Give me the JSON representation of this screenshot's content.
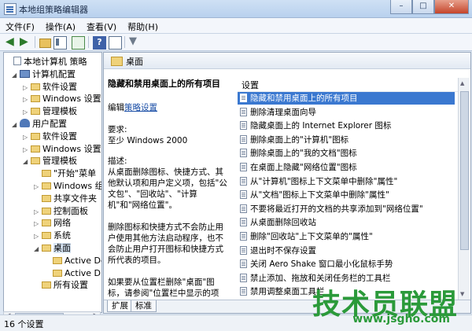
{
  "window": {
    "title": "本地组策略编辑器",
    "buttons": [
      "–",
      "□",
      "✕"
    ]
  },
  "menu": [
    "文件(F)",
    "操作(A)",
    "查看(V)",
    "帮助(H)"
  ],
  "toolbar": {
    "icons": [
      "back-icon",
      "forward-icon",
      "up-folder-icon",
      "show-hide-tree-icon",
      "export-list-icon",
      "help-icon",
      "properties-icon",
      "filter-icon"
    ]
  },
  "tree": {
    "items": [
      {
        "label": "本地计算机 策略",
        "type": "doc",
        "expander": ""
      },
      {
        "label": "计算机配置",
        "type": "comp",
        "expander": "◢"
      },
      {
        "label": "软件设置",
        "type": "folder",
        "expander": "▷"
      },
      {
        "label": "Windows 设置",
        "type": "folder",
        "expander": "▷"
      },
      {
        "label": "管理模板",
        "type": "folder",
        "expander": "▷"
      },
      {
        "label": "用户配置",
        "type": "user",
        "expander": "◢"
      },
      {
        "label": "软件设置",
        "type": "folder",
        "expander": "▷"
      },
      {
        "label": "Windows 设置",
        "type": "folder",
        "expander": "▷"
      },
      {
        "label": "管理模板",
        "type": "folder",
        "expander": "◢"
      },
      {
        "label": "\"开始\"菜单",
        "type": "folder",
        "expander": ""
      },
      {
        "label": "Windows 组",
        "type": "folder",
        "expander": "▷"
      },
      {
        "label": "共享文件夹",
        "type": "folder",
        "expander": ""
      },
      {
        "label": "控制面板",
        "type": "folder",
        "expander": "▷"
      },
      {
        "label": "网络",
        "type": "folder",
        "expander": "▷"
      },
      {
        "label": "系统",
        "type": "folder",
        "expander": "▷"
      },
      {
        "label": "桌面",
        "type": "folder",
        "expander": "◢"
      },
      {
        "label": "Active De",
        "type": "folder",
        "expander": ""
      },
      {
        "label": "Active Dir",
        "type": "folder",
        "expander": ""
      },
      {
        "label": "所有设置",
        "type": "folder",
        "expander": ""
      }
    ]
  },
  "pane": {
    "header": "桌面",
    "desc": {
      "heading": "隐藏和禁用桌面上的所有项目",
      "edit_prefix": "编辑",
      "edit_link": "策略设置",
      "req_label": "要求:",
      "req_value": "至少 Windows 2000",
      "desc_label": "描述:",
      "desc_text": "从桌面删除图标、快捷方式、其他默认项和用户定义项，包括\"公文包\"、\"回收站\"、\"计算机\"和\"网络位置\"。",
      "desc_text2": "删除图标和快捷方式不会防止用户使用其他方法启动程序，也不会防止用户打开图标和快捷方式所代表的项目。",
      "desc_text3": "如果要从位置栏删除\"桌面\"图标，请参阅\"位置栏中显示的项目\"(位于\"用户配置\\管理模板"
    },
    "settings_header": "设置",
    "settings": [
      "隐藏和禁用桌面上的所有项目",
      "删除清理桌面向导",
      "隐藏桌面上的 Internet Explorer 图标",
      "删除桌面上的\"计算机\"图标",
      "删除桌面上的\"我的文档\"图标",
      "在桌面上隐藏\"网络位置\"图标",
      "从\"计算机\"图标上下文菜单中删除\"属性\"",
      "从\"文档\"图标上下文菜单中删除\"属性\"",
      "不要将最近打开的文档的共享添加到\"网络位置\"",
      "从桌面删除回收站",
      "删除\"回收站\"上下文菜单的\"属性\"",
      "退出时不保存设置",
      "关闭 Aero Shake 窗口最小化鼠标手势",
      "禁止添加、拖放和关闭任务栏的工具栏",
      "禁用调整桌面工具栏"
    ],
    "tabs": [
      "扩展",
      "标准"
    ]
  },
  "status": "16 个设置",
  "watermark": {
    "text": "技术员联盟",
    "url": "www.jsgho.com"
  }
}
